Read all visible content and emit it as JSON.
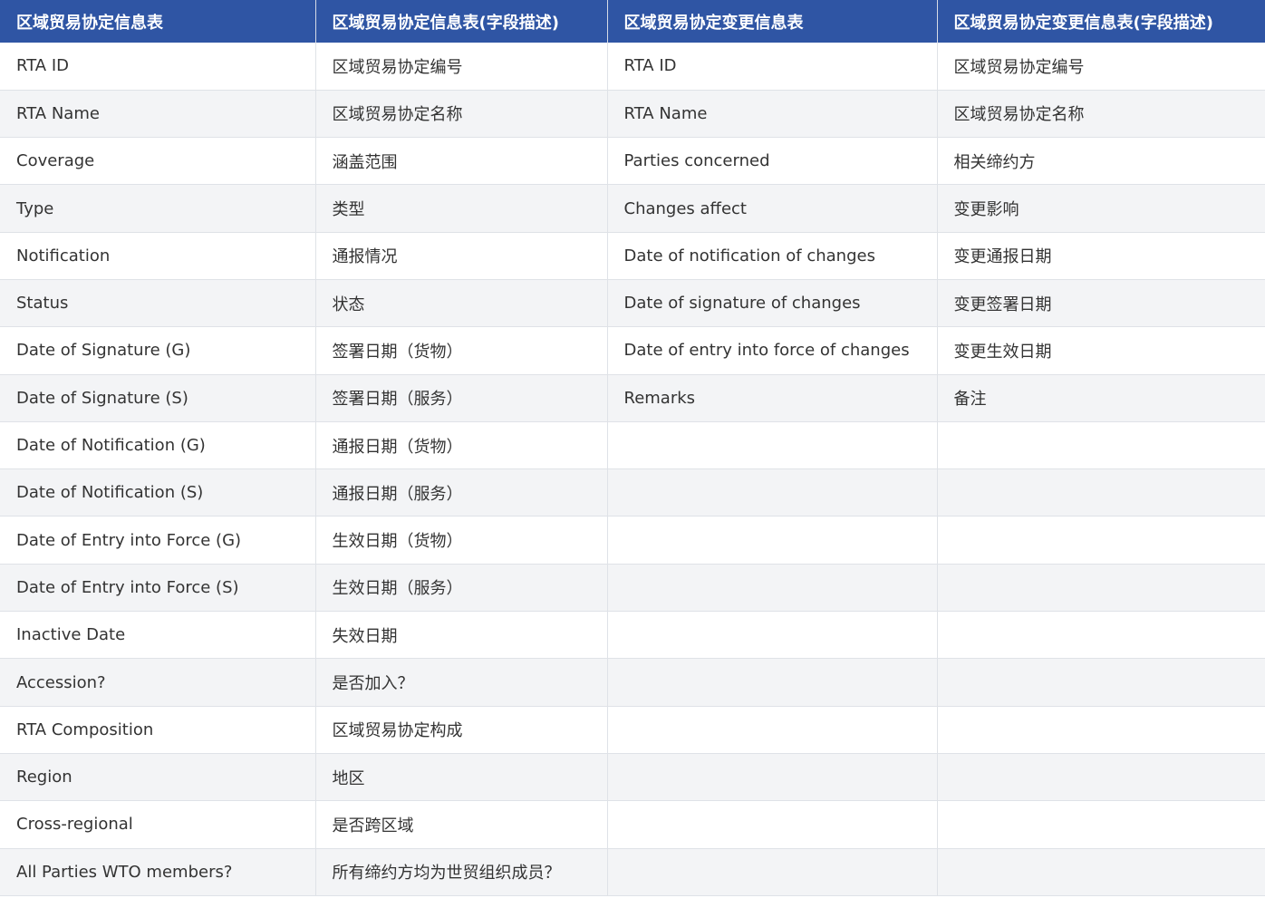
{
  "headers": [
    "区域贸易协定信息表",
    "区域贸易协定信息表(字段描述)",
    "区域贸易协定变更信息表",
    "区域贸易协定变更信息表(字段描述)"
  ],
  "rows": [
    [
      "RTA ID",
      "区域贸易协定编号",
      "RTA ID",
      "区域贸易协定编号"
    ],
    [
      "RTA Name",
      "区域贸易协定名称",
      "RTA Name",
      "区域贸易协定名称"
    ],
    [
      "Coverage",
      "涵盖范围",
      "Parties concerned",
      "相关缔约方"
    ],
    [
      "Type",
      "类型",
      "Changes affect",
      "变更影响"
    ],
    [
      "Notification",
      "通报情况",
      "Date of notification of changes",
      "变更通报日期"
    ],
    [
      "Status",
      "状态",
      "Date of signature of changes",
      "变更签署日期"
    ],
    [
      "Date of Signature (G)",
      "签署日期（货物）",
      "Date of entry into force of changes",
      "变更生效日期"
    ],
    [
      "Date of Signature (S)",
      "签署日期（服务）",
      "Remarks",
      "备注"
    ],
    [
      "Date of Notification (G)",
      "通报日期（货物）",
      "",
      ""
    ],
    [
      "Date of Notification (S)",
      "通报日期（服务）",
      "",
      ""
    ],
    [
      "Date of Entry into Force (G)",
      "生效日期（货物）",
      "",
      ""
    ],
    [
      "Date of Entry into Force (S)",
      "生效日期（服务）",
      "",
      ""
    ],
    [
      "Inactive Date",
      "失效日期",
      "",
      ""
    ],
    [
      "Accession?",
      "是否加入？",
      "",
      ""
    ],
    [
      "RTA Composition",
      "区域贸易协定构成",
      "",
      ""
    ],
    [
      "Region",
      "地区",
      "",
      ""
    ],
    [
      "Cross-regional",
      "是否跨区域",
      "",
      ""
    ],
    [
      "All Parties WTO members?",
      "所有缔约方均为世贸组织成员？",
      "",
      ""
    ]
  ],
  "colors": {
    "header_bg": "#2f55a4",
    "header_text": "#ffffff",
    "row_alt_bg": "#f3f4f6",
    "text": "#333333"
  }
}
